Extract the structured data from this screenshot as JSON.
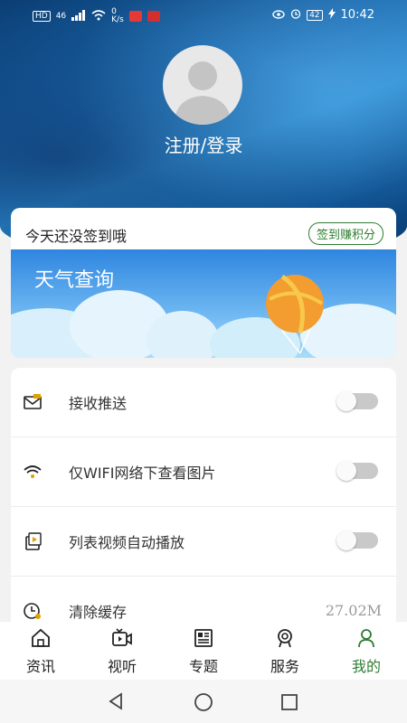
{
  "status_bar": {
    "left_badge": "HD",
    "network": "46",
    "speed": "0\nK/s",
    "battery": "42",
    "time": "10:42"
  },
  "profile": {
    "login_label": "注册/登录"
  },
  "checkin": {
    "text": "今天还没签到哦",
    "button": "签到赚积分"
  },
  "weather": {
    "title": "天气查询"
  },
  "settings": [
    {
      "label": "接收推送",
      "icon": "envelope-icon",
      "control": "toggle",
      "on": false
    },
    {
      "label": "仅WIFI网络下查看图片",
      "icon": "wifi-icon",
      "control": "toggle",
      "on": false
    },
    {
      "label": "列表视频自动播放",
      "icon": "video-play-icon",
      "control": "toggle",
      "on": false
    },
    {
      "label": "清除缓存",
      "icon": "clear-cache-icon",
      "control": "value",
      "value": "27.02M"
    }
  ],
  "tabs": [
    {
      "label": "资讯",
      "icon": "home-icon",
      "active": false
    },
    {
      "label": "视听",
      "icon": "video-icon",
      "active": false
    },
    {
      "label": "专题",
      "icon": "newspaper-icon",
      "active": false
    },
    {
      "label": "服务",
      "icon": "service-icon",
      "active": false
    },
    {
      "label": "我的",
      "icon": "person-icon",
      "active": true
    }
  ],
  "colors": {
    "accent": "#2e7d32",
    "header_blue": "#1b6bb0",
    "toggle_off": "#c9c9c9"
  }
}
